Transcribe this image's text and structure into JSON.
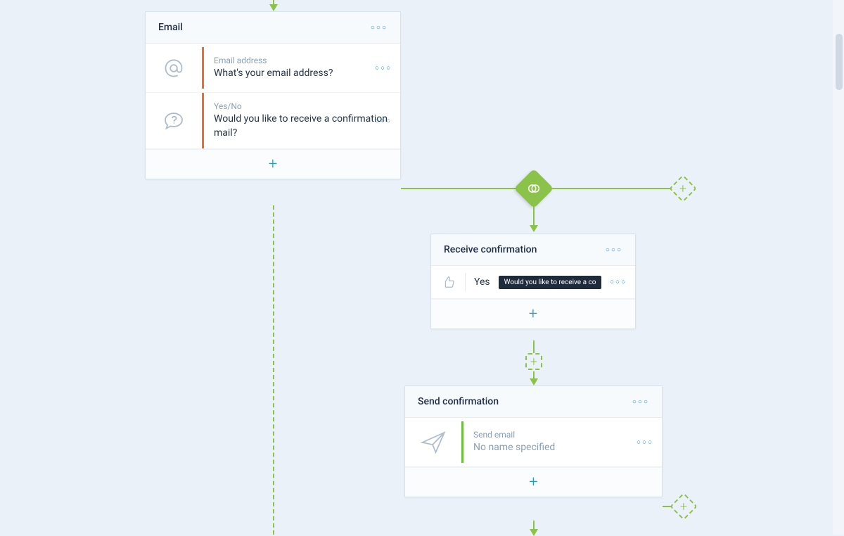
{
  "colors": {
    "accent_blue": "#1a9cdb",
    "accent_green": "#8bc34a",
    "row_orange": "#f26a2e",
    "row_green": "#6cbf3d",
    "chip_bg": "#1f2a3a"
  },
  "nodes": {
    "email": {
      "title": "Email",
      "items": [
        {
          "icon": "at",
          "label": "Email address",
          "text": "What's your email address?",
          "accent": "orange"
        },
        {
          "icon": "question-bubble",
          "label": "Yes/No",
          "text": "Would you like to receive a confirmation mail?",
          "accent": "orange"
        }
      ]
    },
    "receive": {
      "title": "Receive confirmation",
      "condition": {
        "answer": "Yes",
        "ref_text": "Would you like to receive a co"
      }
    },
    "send": {
      "title": "Send confirmation",
      "items": [
        {
          "icon": "paper-plane",
          "label": "Send email",
          "text": "No name specified",
          "accent": "green"
        }
      ]
    }
  }
}
